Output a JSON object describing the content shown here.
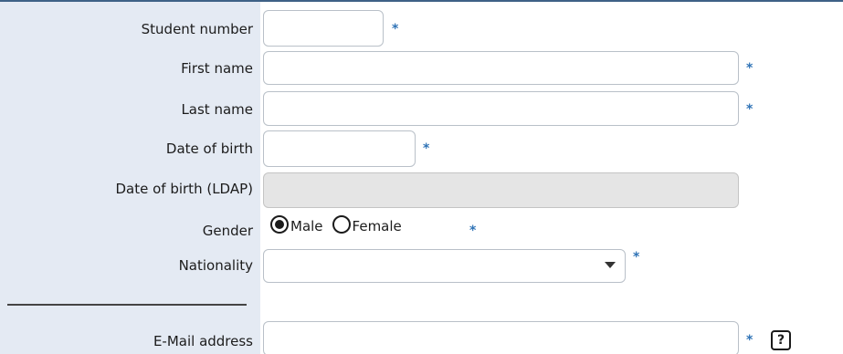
{
  "form": {
    "student_number": {
      "label": "Student number",
      "value": "",
      "required_mark": "*"
    },
    "first_name": {
      "label": "First name",
      "value": "",
      "required_mark": "*"
    },
    "last_name": {
      "label": "Last name",
      "value": "",
      "required_mark": "*"
    },
    "date_of_birth": {
      "label": "Date of birth",
      "value": "",
      "required_mark": "*"
    },
    "date_of_birth_ldap": {
      "label": "Date of birth (LDAP)",
      "value": ""
    },
    "gender": {
      "label": "Gender",
      "options": [
        {
          "label": "Male",
          "checked": true
        },
        {
          "label": "Female",
          "checked": false
        }
      ],
      "required_mark": "*"
    },
    "nationality": {
      "label": "Nationality",
      "selected": "",
      "required_mark": "*"
    },
    "email": {
      "label": "E-Mail address",
      "value": "",
      "required_mark": "*",
      "help_label": "?"
    }
  },
  "colors": {
    "label_column_bg": "#e4eaf3",
    "required_mark": "#2f73b6",
    "top_border": "#3e6186"
  },
  "icons": {
    "select_arrow": "chevron-down-icon",
    "help": "help-icon"
  }
}
